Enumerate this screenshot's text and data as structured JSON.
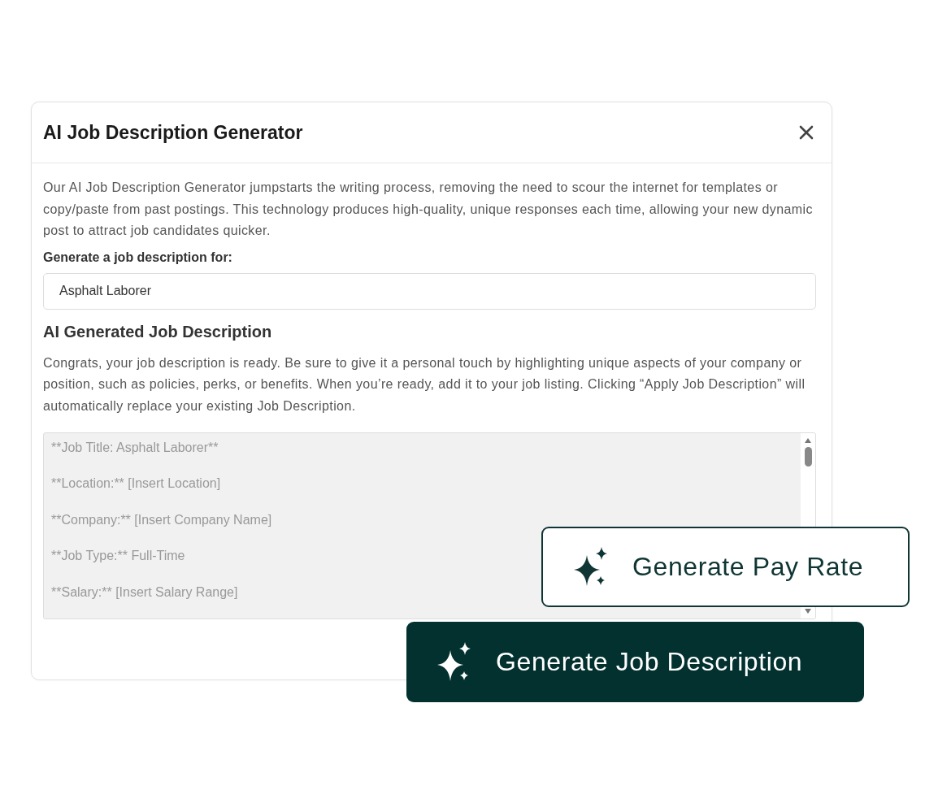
{
  "dialog": {
    "title": "AI Job Description Generator",
    "intro": "Our AI Job Description Generator jumpstarts the writing process, removing the need to scour the internet for templates or copy/paste from past postings. This technology produces high-quality, unique responses each time, allowing your new dynamic post to attract job candidates quicker.",
    "field_label": "Generate a job description for:",
    "field_value": "Asphalt Laborer",
    "section_title": "AI Generated Job Description",
    "section_text": "Congrats, your job description is ready. Be sure to give it a personal touch by highlighting unique aspects of your company or position, such as policies, perks, or benefits. When you’re ready, add it to your job listing. Clicking “Apply Job Description” will automatically replace your existing Job Description.",
    "generated_lines": [
      "**Job Title: Asphalt Laborer**",
      "**Location:** [Insert Location]",
      "**Company:** [Insert Company Name]",
      "**Job Type:** Full-Time",
      "**Salary:** [Insert Salary Range]"
    ]
  },
  "buttons": [
    {
      "label": "Generate Pay Rate",
      "kind": "outline"
    },
    {
      "label": "Generate Job Description",
      "kind": "filled"
    }
  ]
}
